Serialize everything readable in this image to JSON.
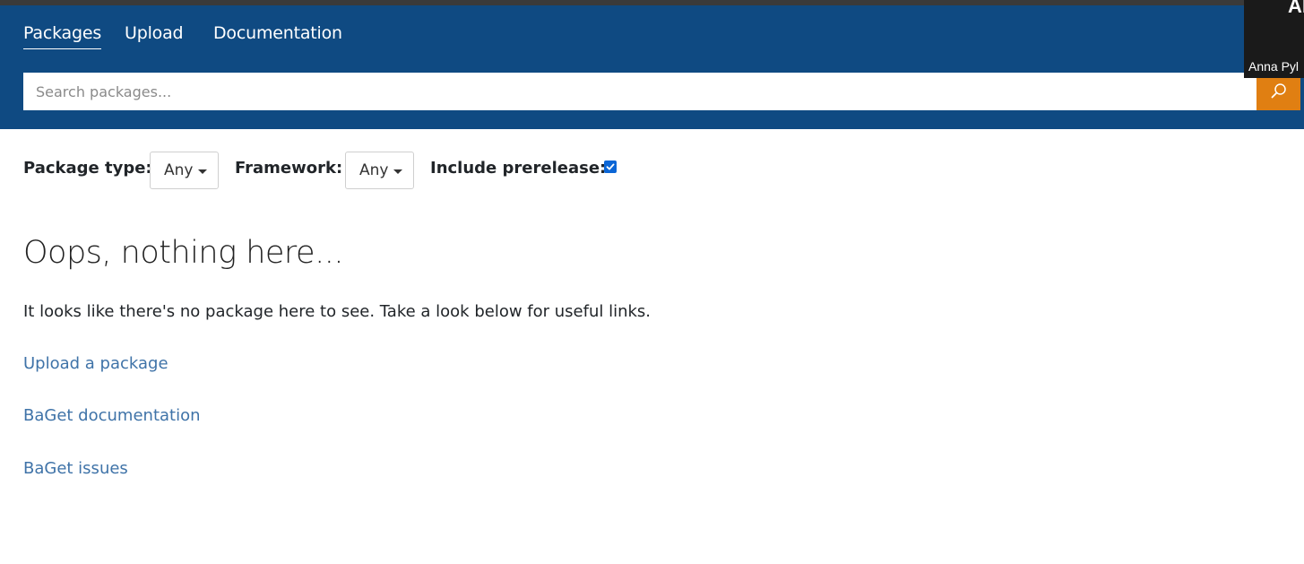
{
  "nav": {
    "items": [
      {
        "label": "Packages",
        "active": true
      },
      {
        "label": "Upload",
        "active": false
      },
      {
        "label": "Documentation",
        "active": false
      }
    ]
  },
  "search": {
    "placeholder": "Search packages...",
    "value": "",
    "button_icon": "search-icon",
    "button_color": "#e07f12"
  },
  "user": {
    "initials": "Al",
    "name": "Anna Pyl"
  },
  "filters": {
    "package_type_label": "Package type:",
    "package_type_value": "Any",
    "framework_label": "Framework:",
    "framework_value": "Any",
    "prerelease_label": "Include prerelease:",
    "prerelease_checked": true
  },
  "content": {
    "heading": "Oops, nothing here...",
    "message": "It looks like there's no package here to see. Take a look below for useful links.",
    "links": [
      {
        "label": "Upload a package"
      },
      {
        "label": "BaGet documentation"
      },
      {
        "label": "BaGet issues"
      }
    ]
  },
  "colors": {
    "navbar": "#0f4a82",
    "link": "#3f73a8",
    "accent": "#e07f12",
    "checkbox": "#0b66d6"
  }
}
